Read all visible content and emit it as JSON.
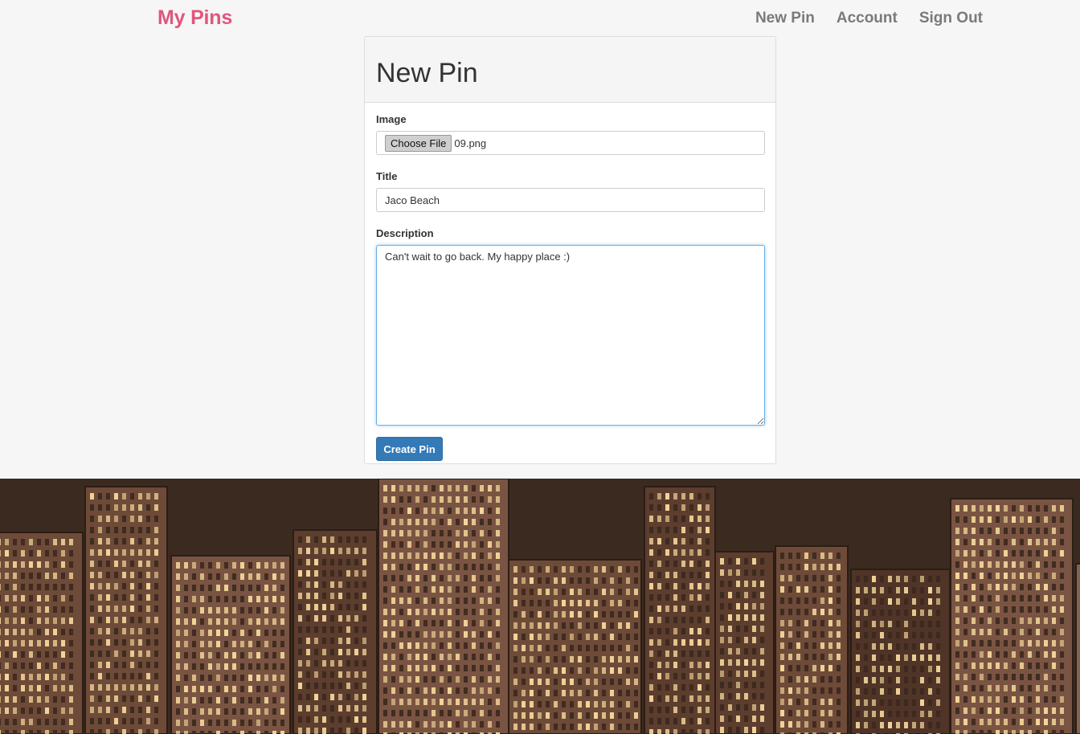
{
  "navbar": {
    "brand": "My Pins",
    "links": [
      {
        "label": "New Pin"
      },
      {
        "label": "Account"
      },
      {
        "label": "Sign Out"
      }
    ]
  },
  "form": {
    "title": "New Pin",
    "image_label": "Image",
    "choose_file_label": "Choose File",
    "file_name": "09.png",
    "title_label": "Title",
    "title_value": "Jaco Beach",
    "description_label": "Description",
    "description_value": "Can't wait to go back. My happy place :)",
    "submit_label": "Create Pin"
  },
  "background": {
    "subject": "aerial night city skyline photo",
    "colors": {
      "sky": "#3a2a20",
      "building": "#6e4a38",
      "window_lit": "#f3d79a"
    }
  },
  "colors": {
    "brand": "#e0567c",
    "nav_link": "#7a7a7a",
    "primary": "#337ab7",
    "focus_border": "#66afe9"
  }
}
